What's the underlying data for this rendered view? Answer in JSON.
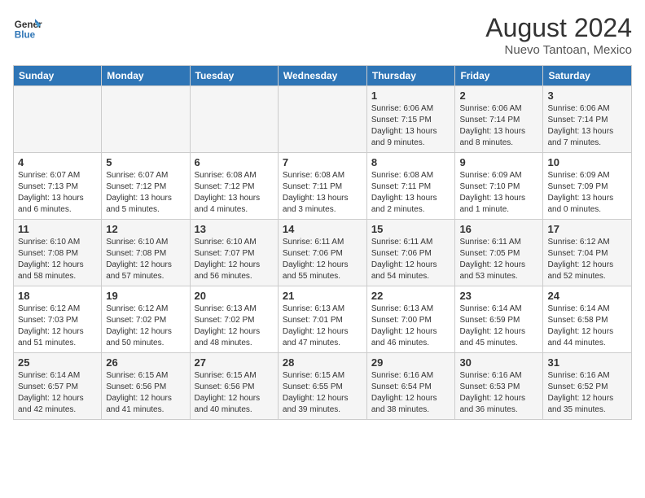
{
  "header": {
    "logo_line1": "General",
    "logo_line2": "Blue",
    "month_year": "August 2024",
    "location": "Nuevo Tantoan, Mexico"
  },
  "weekdays": [
    "Sunday",
    "Monday",
    "Tuesday",
    "Wednesday",
    "Thursday",
    "Friday",
    "Saturday"
  ],
  "weeks": [
    [
      {
        "day": "",
        "info": ""
      },
      {
        "day": "",
        "info": ""
      },
      {
        "day": "",
        "info": ""
      },
      {
        "day": "",
        "info": ""
      },
      {
        "day": "1",
        "info": "Sunrise: 6:06 AM\nSunset: 7:15 PM\nDaylight: 13 hours\nand 9 minutes."
      },
      {
        "day": "2",
        "info": "Sunrise: 6:06 AM\nSunset: 7:14 PM\nDaylight: 13 hours\nand 8 minutes."
      },
      {
        "day": "3",
        "info": "Sunrise: 6:06 AM\nSunset: 7:14 PM\nDaylight: 13 hours\nand 7 minutes."
      }
    ],
    [
      {
        "day": "4",
        "info": "Sunrise: 6:07 AM\nSunset: 7:13 PM\nDaylight: 13 hours\nand 6 minutes."
      },
      {
        "day": "5",
        "info": "Sunrise: 6:07 AM\nSunset: 7:12 PM\nDaylight: 13 hours\nand 5 minutes."
      },
      {
        "day": "6",
        "info": "Sunrise: 6:08 AM\nSunset: 7:12 PM\nDaylight: 13 hours\nand 4 minutes."
      },
      {
        "day": "7",
        "info": "Sunrise: 6:08 AM\nSunset: 7:11 PM\nDaylight: 13 hours\nand 3 minutes."
      },
      {
        "day": "8",
        "info": "Sunrise: 6:08 AM\nSunset: 7:11 PM\nDaylight: 13 hours\nand 2 minutes."
      },
      {
        "day": "9",
        "info": "Sunrise: 6:09 AM\nSunset: 7:10 PM\nDaylight: 13 hours\nand 1 minute."
      },
      {
        "day": "10",
        "info": "Sunrise: 6:09 AM\nSunset: 7:09 PM\nDaylight: 13 hours\nand 0 minutes."
      }
    ],
    [
      {
        "day": "11",
        "info": "Sunrise: 6:10 AM\nSunset: 7:08 PM\nDaylight: 12 hours\nand 58 minutes."
      },
      {
        "day": "12",
        "info": "Sunrise: 6:10 AM\nSunset: 7:08 PM\nDaylight: 12 hours\nand 57 minutes."
      },
      {
        "day": "13",
        "info": "Sunrise: 6:10 AM\nSunset: 7:07 PM\nDaylight: 12 hours\nand 56 minutes."
      },
      {
        "day": "14",
        "info": "Sunrise: 6:11 AM\nSunset: 7:06 PM\nDaylight: 12 hours\nand 55 minutes."
      },
      {
        "day": "15",
        "info": "Sunrise: 6:11 AM\nSunset: 7:06 PM\nDaylight: 12 hours\nand 54 minutes."
      },
      {
        "day": "16",
        "info": "Sunrise: 6:11 AM\nSunset: 7:05 PM\nDaylight: 12 hours\nand 53 minutes."
      },
      {
        "day": "17",
        "info": "Sunrise: 6:12 AM\nSunset: 7:04 PM\nDaylight: 12 hours\nand 52 minutes."
      }
    ],
    [
      {
        "day": "18",
        "info": "Sunrise: 6:12 AM\nSunset: 7:03 PM\nDaylight: 12 hours\nand 51 minutes."
      },
      {
        "day": "19",
        "info": "Sunrise: 6:12 AM\nSunset: 7:02 PM\nDaylight: 12 hours\nand 50 minutes."
      },
      {
        "day": "20",
        "info": "Sunrise: 6:13 AM\nSunset: 7:02 PM\nDaylight: 12 hours\nand 48 minutes."
      },
      {
        "day": "21",
        "info": "Sunrise: 6:13 AM\nSunset: 7:01 PM\nDaylight: 12 hours\nand 47 minutes."
      },
      {
        "day": "22",
        "info": "Sunrise: 6:13 AM\nSunset: 7:00 PM\nDaylight: 12 hours\nand 46 minutes."
      },
      {
        "day": "23",
        "info": "Sunrise: 6:14 AM\nSunset: 6:59 PM\nDaylight: 12 hours\nand 45 minutes."
      },
      {
        "day": "24",
        "info": "Sunrise: 6:14 AM\nSunset: 6:58 PM\nDaylight: 12 hours\nand 44 minutes."
      }
    ],
    [
      {
        "day": "25",
        "info": "Sunrise: 6:14 AM\nSunset: 6:57 PM\nDaylight: 12 hours\nand 42 minutes."
      },
      {
        "day": "26",
        "info": "Sunrise: 6:15 AM\nSunset: 6:56 PM\nDaylight: 12 hours\nand 41 minutes."
      },
      {
        "day": "27",
        "info": "Sunrise: 6:15 AM\nSunset: 6:56 PM\nDaylight: 12 hours\nand 40 minutes."
      },
      {
        "day": "28",
        "info": "Sunrise: 6:15 AM\nSunset: 6:55 PM\nDaylight: 12 hours\nand 39 minutes."
      },
      {
        "day": "29",
        "info": "Sunrise: 6:16 AM\nSunset: 6:54 PM\nDaylight: 12 hours\nand 38 minutes."
      },
      {
        "day": "30",
        "info": "Sunrise: 6:16 AM\nSunset: 6:53 PM\nDaylight: 12 hours\nand 36 minutes."
      },
      {
        "day": "31",
        "info": "Sunrise: 6:16 AM\nSunset: 6:52 PM\nDaylight: 12 hours\nand 35 minutes."
      }
    ]
  ]
}
